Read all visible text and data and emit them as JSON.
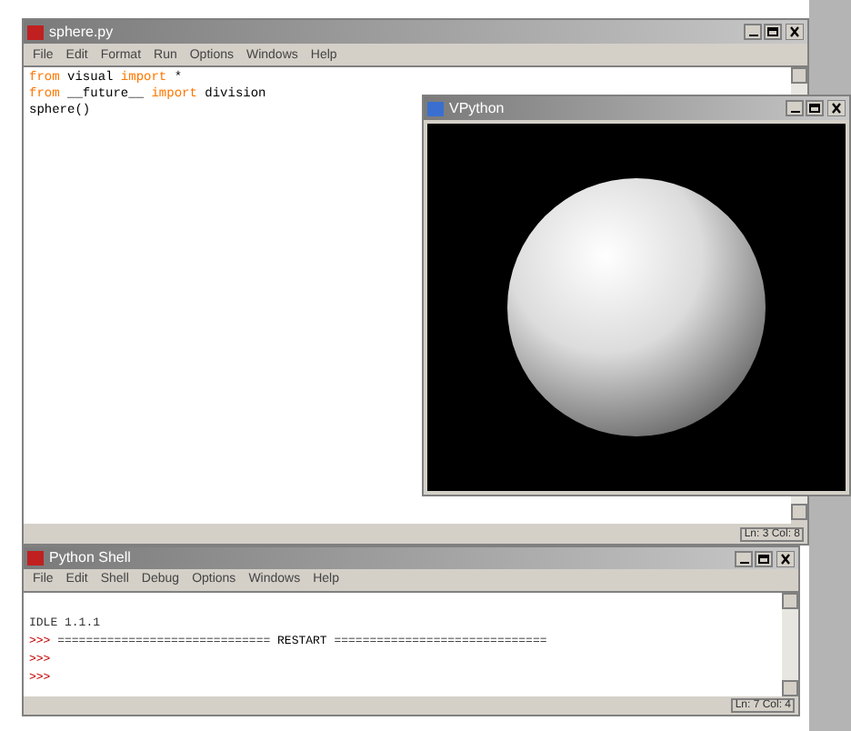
{
  "editor": {
    "title": "sphere.py",
    "menu": [
      "File",
      "Edit",
      "Format",
      "Run",
      "Options",
      "Windows",
      "Help"
    ],
    "lines": [
      [
        {
          "t": "from",
          "kind": "keyword"
        },
        {
          "t": " visual ",
          "kind": "plain"
        },
        {
          "t": "import",
          "kind": "keyword"
        },
        {
          "t": " *",
          "kind": "plain"
        }
      ],
      [
        {
          "t": "from",
          "kind": "keyword"
        },
        {
          "t": " __future__ ",
          "kind": "plain"
        },
        {
          "t": "import",
          "kind": "keyword"
        },
        {
          "t": " division",
          "kind": "plain"
        }
      ],
      [
        {
          "t": "sphere()",
          "kind": "plain"
        }
      ]
    ],
    "status": "Ln: 3 Col: 8"
  },
  "vpython": {
    "title": "VPython"
  },
  "shell": {
    "title": "Python Shell",
    "menu": [
      "File",
      "Edit",
      "Shell",
      "Debug",
      "Options",
      "Windows",
      "Help"
    ],
    "lines": [
      {
        "kind": "output",
        "text": "IDLE 1.1.1"
      },
      {
        "kind": "prompt",
        "prompt": ">>>",
        "text": " ============================== RESTART =============================="
      },
      {
        "kind": "prompt",
        "prompt": ">>>"
      },
      {
        "kind": "prompt",
        "prompt": ">>>"
      }
    ],
    "status": "Ln: 7 Col: 4"
  }
}
